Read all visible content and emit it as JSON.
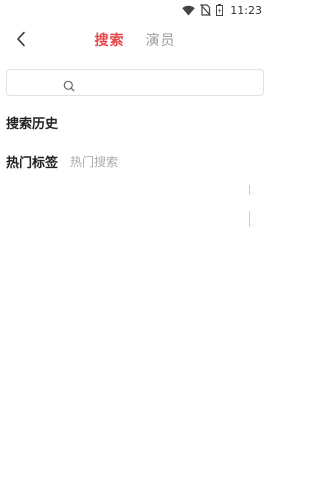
{
  "status_bar": {
    "time": "11:23",
    "icons": [
      "wifi-icon",
      "no-sim-icon",
      "battery-icon"
    ]
  },
  "header": {
    "back_icon": "chevron-left-icon",
    "tabs": [
      {
        "label": "搜索",
        "active": true
      },
      {
        "label": "演员",
        "active": false
      }
    ]
  },
  "search": {
    "value": "",
    "icon": "search-icon"
  },
  "history": {
    "title": "搜索历史"
  },
  "hot": {
    "title": "热门标签",
    "tags": [
      "热门搜索"
    ]
  },
  "colors": {
    "accent": "#e8474a",
    "muted": "#999999",
    "border": "#e1e1e1"
  }
}
